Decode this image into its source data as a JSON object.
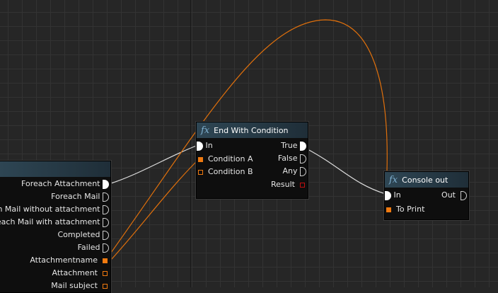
{
  "nodes": {
    "foreach": {
      "outputs": [
        "Foreach Attachment",
        "Foreach Mail",
        "ach Mail without attachment",
        "oreach Mail with attachment",
        "Completed",
        "Failed",
        "Attachmentname",
        "Attachment",
        "Mail subject"
      ]
    },
    "end_with_condition": {
      "title": "End With Condition",
      "fx": "fx",
      "inputs": [
        "In",
        "Condition A",
        "Condition B"
      ],
      "outputs": [
        "True",
        "False",
        "Any",
        "Result"
      ]
    },
    "console_out": {
      "title": "Console out",
      "fx": "fx",
      "inputs": [
        "In",
        "To Print"
      ],
      "outputs": [
        "Out"
      ]
    }
  },
  "colors": {
    "wire_exec": "#dddddd",
    "wire_data": "#e0700c"
  }
}
